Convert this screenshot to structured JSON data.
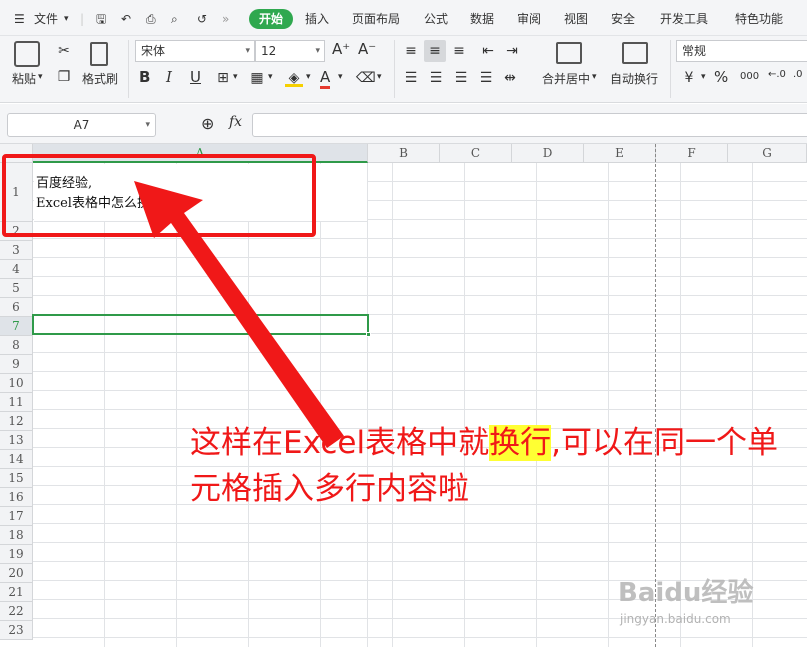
{
  "menu": {
    "file_label": "文件",
    "tabs": [
      "开始",
      "插入",
      "页面布局",
      "公式",
      "数据",
      "审阅",
      "视图",
      "安全",
      "开发工具",
      "特色功能"
    ],
    "active_tab": "开始"
  },
  "ribbon": {
    "paste_label": "粘贴",
    "format_painter_label": "格式刷",
    "font_name": "宋体",
    "font_size": "12",
    "merge_center_label": "合并居中",
    "wrap_text_label": "自动换行",
    "number_format": "常规",
    "bold": "B",
    "italic": "I",
    "underline": "U",
    "percent": "%",
    "thousands": "000"
  },
  "formula_bar": {
    "name_box": "A7",
    "fx_label": "fx",
    "content": ""
  },
  "sheet": {
    "columns": [
      "A",
      "B",
      "C",
      "D",
      "E",
      "F",
      "G"
    ],
    "selected_column": "A",
    "rows": [
      "1",
      "2",
      "3",
      "4",
      "5",
      "6",
      "7",
      "8",
      "9",
      "10",
      "11",
      "12",
      "13",
      "14",
      "15",
      "16",
      "17",
      "18",
      "19",
      "20",
      "21",
      "22",
      "23"
    ],
    "selected_row": "7",
    "cell_A1_line1": "百度经验,",
    "cell_A1_line2": "Excel表格中怎么换行呢?"
  },
  "annotation": {
    "text_part1": "这样在Excel表格中就",
    "text_highlight": "换行",
    "text_part2": ",可以在同一个单元格插入多行内容啦",
    "color": "#f01818"
  },
  "watermark": {
    "main": "Baidu经验",
    "sub": "jingyan.baidu.com"
  }
}
